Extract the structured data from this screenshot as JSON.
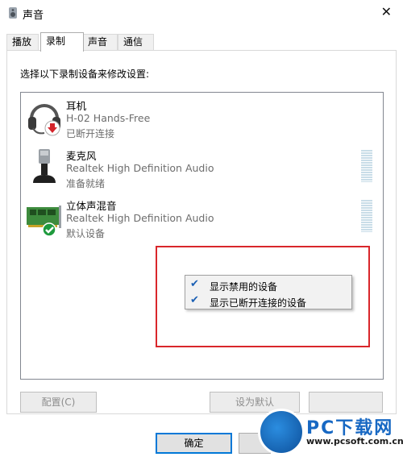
{
  "window": {
    "title": "声音",
    "close": "✕"
  },
  "tabs": [
    {
      "label": "播放"
    },
    {
      "label": "录制"
    },
    {
      "label": "声音"
    },
    {
      "label": "通信"
    }
  ],
  "instruction": "选择以下录制设备来修改设置:",
  "devices": [
    {
      "name": "耳机",
      "desc": "H-02 Hands-Free",
      "status": "已断开连接",
      "icon": "headset-icon"
    },
    {
      "name": "麦克风",
      "desc": "Realtek High Definition Audio",
      "status": "准备就绪",
      "icon": "microphone-icon"
    },
    {
      "name": "立体声混音",
      "desc": "Realtek High Definition Audio",
      "status": "默认设备",
      "icon": "sound-card-icon"
    }
  ],
  "context_menu": [
    {
      "label": "显示禁用的设备",
      "checked": true
    },
    {
      "label": "显示已断开连接的设备",
      "checked": true
    }
  ],
  "buttons": {
    "configure": "配置(C)",
    "set_default": "设为默认",
    "ok": "确定"
  },
  "watermark": {
    "title": "PC下载网",
    "url": "www.pcsoft.com.cn"
  },
  "colors": {
    "highlight_box": "#d9262b",
    "accent": "#0078d7"
  }
}
